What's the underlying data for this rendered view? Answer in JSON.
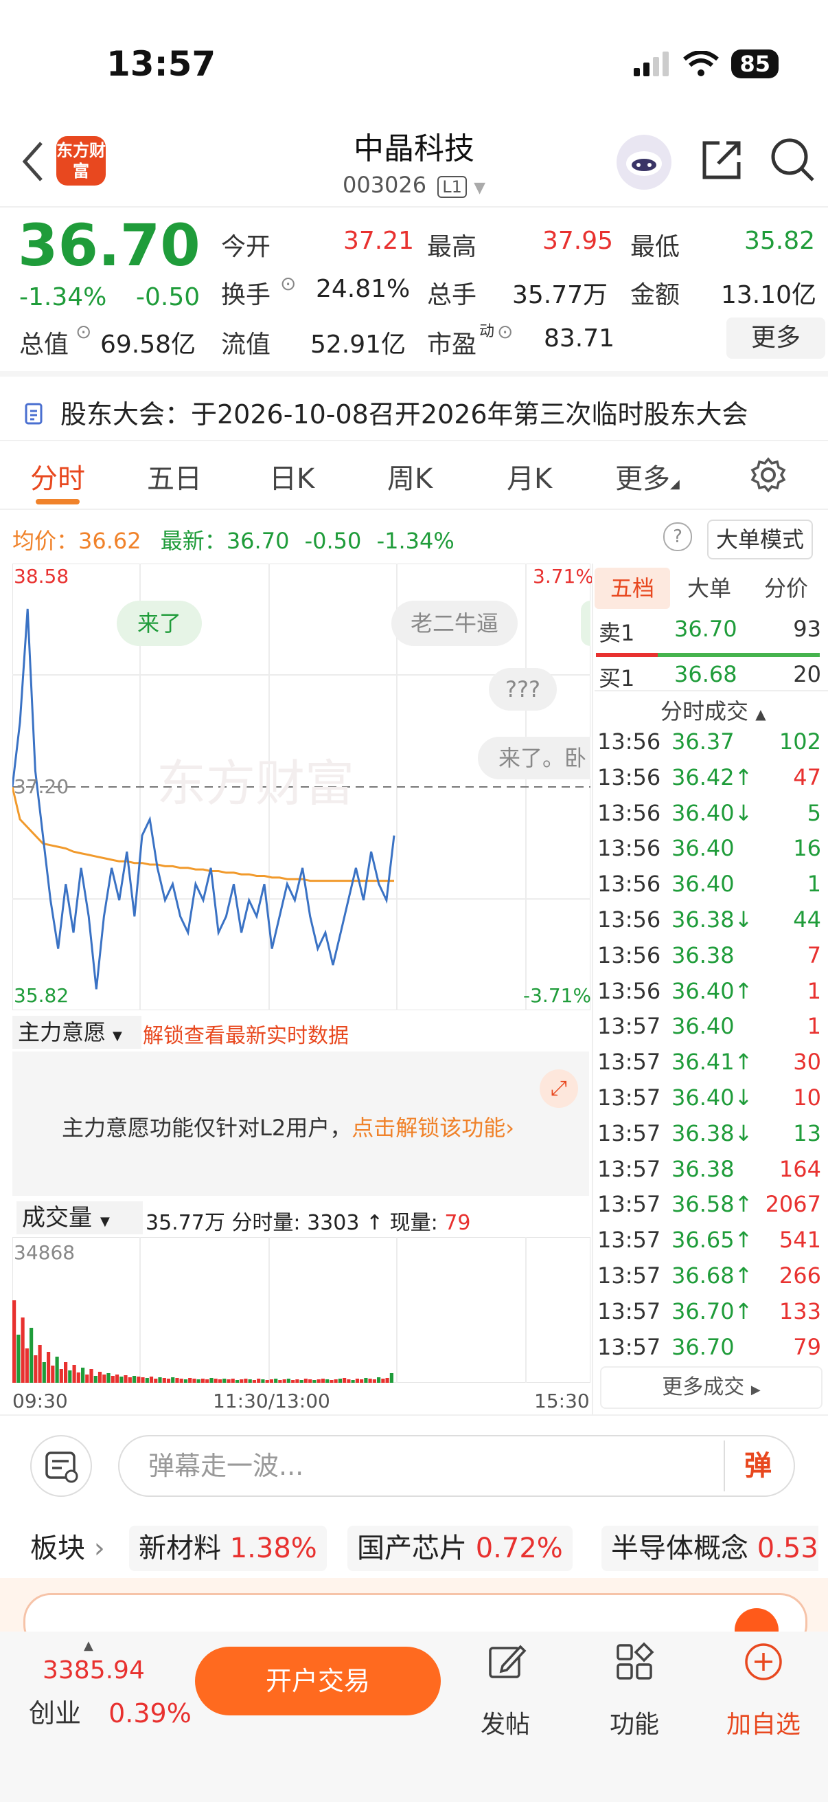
{
  "status": {
    "time": "13:57",
    "battery": "85"
  },
  "header": {
    "logo_text": "东方财富",
    "stock_name": "中晶科技",
    "stock_code": "003026",
    "level": "L1"
  },
  "quote": {
    "price": "36.70",
    "change_pct": "-1.34%",
    "change": "-0.50",
    "open_label": "今开",
    "open": "37.21",
    "high_label": "最高",
    "high": "37.95",
    "low_label": "最低",
    "low": "35.82",
    "turnover_label": "换手",
    "turnover": "24.81%",
    "volume_label": "总手",
    "volume": "35.77万",
    "amount_label": "金额",
    "amount": "13.10亿",
    "mktcap_label": "总值",
    "mktcap": "69.58亿",
    "float_label": "流值",
    "float": "52.91亿",
    "pe_label": "市盈",
    "pe_sup": "动",
    "pe": "83.71",
    "more": "更多"
  },
  "notice": "股东大会：于2026-10-08召开2026年第三次临时股东大会",
  "tabs": [
    "分时",
    "五日",
    "日K",
    "周K",
    "月K",
    "更多"
  ],
  "avg_row": {
    "avg_label": "均价：",
    "avg": "36.62",
    "latest_label": "最新：",
    "latest": "36.70",
    "chg": "-0.50",
    "pct": "-1.34%",
    "big_order": "大单模式"
  },
  "chart": {
    "y_top": "38.58",
    "y_mid": "37.20",
    "y_bottom": "35.82",
    "pct_top": "3.71%",
    "pct_bottom": "-3.71%",
    "danmu": [
      "来了",
      "老二牛逼",
      "???",
      "来了。卧"
    ],
    "watermark": "东方财富",
    "x_start": "09:30",
    "x_mid": "11:30/13:00",
    "x_end": "15:30"
  },
  "chart_data": {
    "type": "line",
    "title": "",
    "ylim": [
      35.82,
      38.58
    ],
    "series": [
      {
        "values": [
          37.2,
          37.6,
          38.3,
          37.3,
          36.9,
          36.5,
          36.2,
          36.6,
          36.3,
          36.7,
          36.4,
          35.95,
          36.4,
          36.7,
          36.5,
          36.8,
          36.4,
          36.9,
          37.0,
          36.7,
          36.5,
          36.6,
          36.4,
          36.3,
          36.6,
          36.5,
          36.7,
          36.3,
          36.4,
          36.6,
          36.3,
          36.5,
          36.4,
          36.6,
          36.2,
          36.4,
          36.6,
          36.5,
          36.7,
          36.4,
          36.2,
          36.3,
          36.1,
          36.3,
          36.5,
          36.7,
          36.5,
          36.8,
          36.6,
          36.5,
          36.9
        ]
      },
      {
        "values": [
          37.2,
          37.0,
          36.95,
          36.9,
          36.85,
          36.84,
          36.83,
          36.82,
          36.8,
          36.79,
          36.78,
          36.77,
          36.76,
          36.75,
          36.74,
          36.74,
          36.73,
          36.73,
          36.72,
          36.72,
          36.71,
          36.71,
          36.7,
          36.7,
          36.69,
          36.69,
          36.68,
          36.68,
          36.67,
          36.67,
          36.66,
          36.66,
          36.65,
          36.65,
          36.64,
          36.64,
          36.63,
          36.63,
          36.63,
          36.62,
          36.62,
          36.62,
          36.62,
          36.62,
          36.62,
          36.62,
          36.62,
          36.62,
          36.62,
          36.62,
          36.62
        ]
      }
    ]
  },
  "volume_chart": {
    "label": "成交量",
    "total": "35.77万",
    "period_label": "分时量:",
    "period": "3303",
    "now_label": "现量:",
    "now": "79",
    "max": "34868"
  },
  "zlyy": {
    "label": "主力意愿",
    "unlock": "解锁查看最新实时数据",
    "text": "主力意愿功能仅针对L2用户，",
    "link": "点击解锁该功能"
  },
  "depth": {
    "tabs": [
      "五档",
      "大单",
      "分价"
    ],
    "sell1": {
      "label": "卖1",
      "price": "36.70",
      "vol": "93"
    },
    "buy1": {
      "label": "买1",
      "price": "36.68",
      "vol": "20"
    },
    "ticks_title": "分时成交",
    "ticks": [
      {
        "t": "13:56",
        "p": "36.37",
        "d": "",
        "v": "102",
        "pc": "green",
        "vc": "green"
      },
      {
        "t": "13:56",
        "p": "36.42",
        "d": "↑",
        "v": "47",
        "pc": "green",
        "vc": "red"
      },
      {
        "t": "13:56",
        "p": "36.40",
        "d": "↓",
        "v": "5",
        "pc": "green",
        "vc": "green"
      },
      {
        "t": "13:56",
        "p": "36.40",
        "d": "",
        "v": "16",
        "pc": "green",
        "vc": "green"
      },
      {
        "t": "13:56",
        "p": "36.40",
        "d": "",
        "v": "1",
        "pc": "green",
        "vc": "green"
      },
      {
        "t": "13:56",
        "p": "36.38",
        "d": "↓",
        "v": "44",
        "pc": "green",
        "vc": "green"
      },
      {
        "t": "13:56",
        "p": "36.38",
        "d": "",
        "v": "7",
        "pc": "green",
        "vc": "red"
      },
      {
        "t": "13:56",
        "p": "36.40",
        "d": "↑",
        "v": "1",
        "pc": "green",
        "vc": "red"
      },
      {
        "t": "13:57",
        "p": "36.40",
        "d": "",
        "v": "1",
        "pc": "green",
        "vc": "red"
      },
      {
        "t": "13:57",
        "p": "36.41",
        "d": "↑",
        "v": "30",
        "pc": "green",
        "vc": "red"
      },
      {
        "t": "13:57",
        "p": "36.40",
        "d": "↓",
        "v": "10",
        "pc": "green",
        "vc": "red"
      },
      {
        "t": "13:57",
        "p": "36.38",
        "d": "↓",
        "v": "13",
        "pc": "green",
        "vc": "green"
      },
      {
        "t": "13:57",
        "p": "36.38",
        "d": "",
        "v": "164",
        "pc": "green",
        "vc": "red"
      },
      {
        "t": "13:57",
        "p": "36.58",
        "d": "↑",
        "v": "2067",
        "pc": "green",
        "vc": "red"
      },
      {
        "t": "13:57",
        "p": "36.65",
        "d": "↑",
        "v": "541",
        "pc": "green",
        "vc": "red"
      },
      {
        "t": "13:57",
        "p": "36.68",
        "d": "↑",
        "v": "266",
        "pc": "green",
        "vc": "red"
      },
      {
        "t": "13:57",
        "p": "36.70",
        "d": "↑",
        "v": "133",
        "pc": "green",
        "vc": "red"
      },
      {
        "t": "13:57",
        "p": "36.70",
        "d": "",
        "v": "79",
        "pc": "green",
        "vc": "red"
      }
    ],
    "more_trades": "更多成交"
  },
  "danmu_input": {
    "placeholder": "弹幕走一波...",
    "send": "弹"
  },
  "sectors": {
    "label": "板块",
    "items": [
      {
        "name": "新材料",
        "pct": "1.38%"
      },
      {
        "name": "国产芯片",
        "pct": "0.72%"
      },
      {
        "name": "半导体概念",
        "pct": "0.53"
      }
    ]
  },
  "bottom": {
    "index_value": "3385.94",
    "index_name": "创业",
    "index_pct": "0.39%",
    "trade": "开户交易",
    "post": "发帖",
    "func": "功能",
    "add": "加自选"
  },
  "colors": {
    "up": "#e8312f",
    "down": "#1f9c3a",
    "accent": "#f0822a",
    "brand": "#e8481f"
  }
}
